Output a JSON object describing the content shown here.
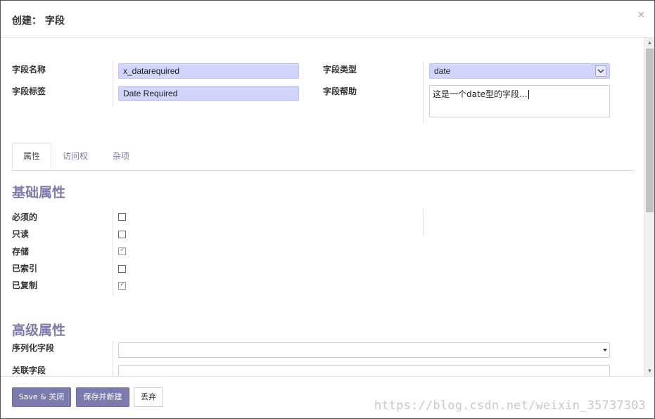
{
  "dialog": {
    "title": "创建： 字段",
    "close_symbol": "×"
  },
  "form": {
    "field_name_label": "字段名称",
    "field_name_value": "x_datarequired",
    "field_label_label": "字段标签",
    "field_label_value": "Date Required",
    "field_type_label": "字段类型",
    "field_type_value": "date",
    "field_help_label": "字段帮助",
    "field_help_value": "这是一个date型的字段..."
  },
  "tabs": [
    {
      "label": "属性",
      "active": true
    },
    {
      "label": "访问权",
      "active": false
    },
    {
      "label": "杂项",
      "active": false
    }
  ],
  "basic": {
    "title": "基础属性",
    "items": [
      {
        "label": "必须的",
        "checked": false
      },
      {
        "label": "只读",
        "checked": false
      },
      {
        "label": "存储",
        "checked": true
      },
      {
        "label": "已索引",
        "checked": false
      },
      {
        "label": "已复制",
        "checked": true
      }
    ]
  },
  "advanced": {
    "title": "高级属性",
    "serialization_label": "序列化字段",
    "serialization_value": "",
    "related_label": "关联字段",
    "related_value": ""
  },
  "footer": {
    "save_close": "Save & 关闭",
    "save_new": "保存并新建",
    "discard": "丢弃",
    "watermark": "https://blog.csdn.net/weixin_35737303"
  },
  "colors": {
    "accent": "#7c7bad",
    "input_bg": "#d1d4fb"
  }
}
